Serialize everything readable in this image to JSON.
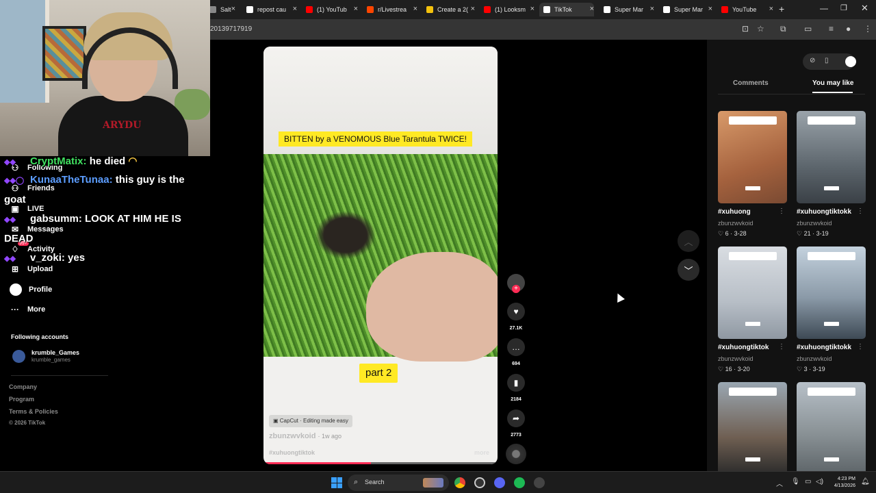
{
  "browser": {
    "tabs": [
      {
        "title": "Salt",
        "color": "#888888"
      },
      {
        "title": "repost cau",
        "color": "#ffffff"
      },
      {
        "title": "(1) YouTub",
        "color": "#ff0000"
      },
      {
        "title": "r/Livestrea",
        "color": "#ff4500"
      },
      {
        "title": "Create a 2(",
        "color": "#f4c20d"
      },
      {
        "title": "(1) Looksm",
        "color": "#ff0000"
      },
      {
        "title": "TikTok",
        "color": "#ffffff",
        "active": true
      },
      {
        "title": "Super Mar",
        "color": "#ffffff"
      },
      {
        "title": "Super Mar",
        "color": "#ffffff"
      },
      {
        "title": "YouTube",
        "color": "#ff0000"
      }
    ],
    "url": "20139717919"
  },
  "left_nav": {
    "items": [
      {
        "label": "Following",
        "icon": "following-icon"
      },
      {
        "label": "Friends",
        "icon": "friends-icon"
      },
      {
        "label": "LIVE",
        "icon": "live-icon"
      },
      {
        "label": "Messages",
        "icon": "messages-icon"
      },
      {
        "label": "Activity",
        "icon": "activity-icon"
      },
      {
        "label": "Upload",
        "icon": "upload-icon"
      },
      {
        "label": "Profile",
        "icon": "profile-icon"
      },
      {
        "label": "More",
        "icon": "more-icon"
      }
    ],
    "activity_badge": "99+",
    "following_title": "Following accounts",
    "following_accounts": [
      {
        "name": "krumble_Games",
        "handle": "krumble_games"
      }
    ],
    "footer_links": [
      "Company",
      "Program",
      "Terms & Policies",
      "© 2026 TikTok"
    ]
  },
  "chat": {
    "messages": [
      {
        "user": "CryptMatix:",
        "text": "he died",
        "user_color": "#40e060"
      },
      {
        "user": "KunaaTheTunaa:",
        "text": "this guy is the",
        "user_color": "#5c9dff"
      },
      {
        "user": "",
        "text": "goat",
        "user_color": "#ffffff"
      },
      {
        "user": "gabsumm:",
        "text": "LOOK AT HIM HE IS",
        "user_color": "#ffffff"
      },
      {
        "user": "",
        "text": "DEAD",
        "user_color": "#ffffff"
      },
      {
        "user": "v_zoki:",
        "text": "yes",
        "user_color": "#ffffff"
      }
    ]
  },
  "webcam": {
    "shirt_text": "ARYDU"
  },
  "video": {
    "title_caption": "BITTEN by a VENOMOUS Blue Tarantula TWICE!",
    "part_caption": "part 2",
    "capcut_label": "CapCut · Editing made easy",
    "author": "zbunzwvkoid",
    "age": "· 1w ago",
    "hashtag": "#xuhuongtiktok",
    "more_label": "more",
    "progress": 0.46
  },
  "actions": {
    "likes": "27.1K",
    "comments": "694",
    "saves": "2184",
    "shares": "2773"
  },
  "panel": {
    "tab_comments": "Comments",
    "tab_you_may_like": "You may like",
    "recommendations": [
      {
        "title": "#xuhuong",
        "author": "zbunzwvkoid",
        "likes": "6",
        "date": "3-28",
        "thumb": "climb"
      },
      {
        "title": "#xuhuongtiktokk",
        "author": "zbunzwvkoid",
        "likes": "21",
        "date": "3-19",
        "thumb": "gym"
      },
      {
        "title": "#xuhuongtiktok",
        "author": "zbunzwvkoid",
        "likes": "16",
        "date": "3-20",
        "thumb": "room"
      },
      {
        "title": "#xuhuongtiktokk",
        "author": "zbunzwvkoid",
        "likes": "3",
        "date": "3-19",
        "thumb": "street"
      },
      {
        "title": "",
        "author": "",
        "likes": "",
        "date": "",
        "thumb": "people"
      },
      {
        "title": "",
        "author": "",
        "likes": "",
        "date": "",
        "thumb": "town"
      }
    ]
  },
  "taskbar": {
    "search_label": "Search",
    "time": "4:23 PM",
    "date": "4/13/2026"
  }
}
